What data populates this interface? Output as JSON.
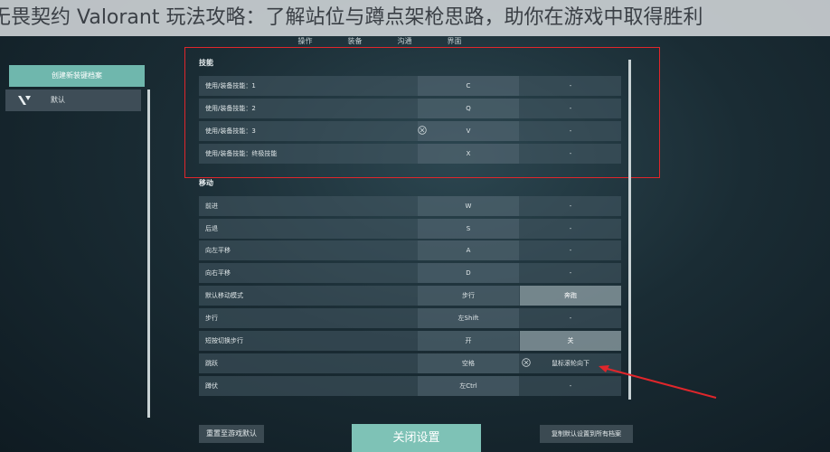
{
  "overlay_title": "无畏契约 Valorant 玩法攻略：了解站位与蹲点架枪思路，助你在游戏中取得胜利",
  "tabs": [
    "操作",
    "装备",
    "沟通",
    "界面"
  ],
  "profiles": {
    "create_label": "创建新装键档案",
    "items": [
      {
        "label": "默认"
      }
    ]
  },
  "sections": [
    {
      "title": "技能",
      "rows": [
        {
          "name": "使用/装备技能：1",
          "key1": "C",
          "key2": "-"
        },
        {
          "name": "使用/装备技能：2",
          "key1": "Q",
          "key2": "-"
        },
        {
          "name": "使用/装备技能：3",
          "key1": "V",
          "key2": "-"
        },
        {
          "name": "使用/装备技能：终极技能",
          "key1": "X",
          "key2": "-"
        }
      ]
    },
    {
      "title": "移动",
      "rows": [
        {
          "name": "前进",
          "key1": "W",
          "key2": "-"
        },
        {
          "name": "后退",
          "key1": "S",
          "key2": "-"
        },
        {
          "name": "向左平移",
          "key1": "A",
          "key2": "-"
        },
        {
          "name": "向右平移",
          "key1": "D",
          "key2": "-"
        },
        {
          "name": "默认移动模式",
          "key1": "步行",
          "key2": "奔跑"
        },
        {
          "name": "步行",
          "key1": "左Shift",
          "key2": "-"
        },
        {
          "name": "短按切换步行",
          "key1": "开",
          "key2": "关"
        },
        {
          "name": "跳跃",
          "key1": "空格",
          "key2": "鼠标滚轮向下"
        },
        {
          "name": "蹲伏",
          "key1": "左Ctrl",
          "key2": "-"
        }
      ]
    }
  ],
  "buttons": {
    "reset": "重置至游戏默认",
    "close": "关闭设置",
    "copy": "复制默认设置到所有档案"
  },
  "colors": {
    "accent": "#7ec2b6",
    "highlight": "#e0262b"
  }
}
